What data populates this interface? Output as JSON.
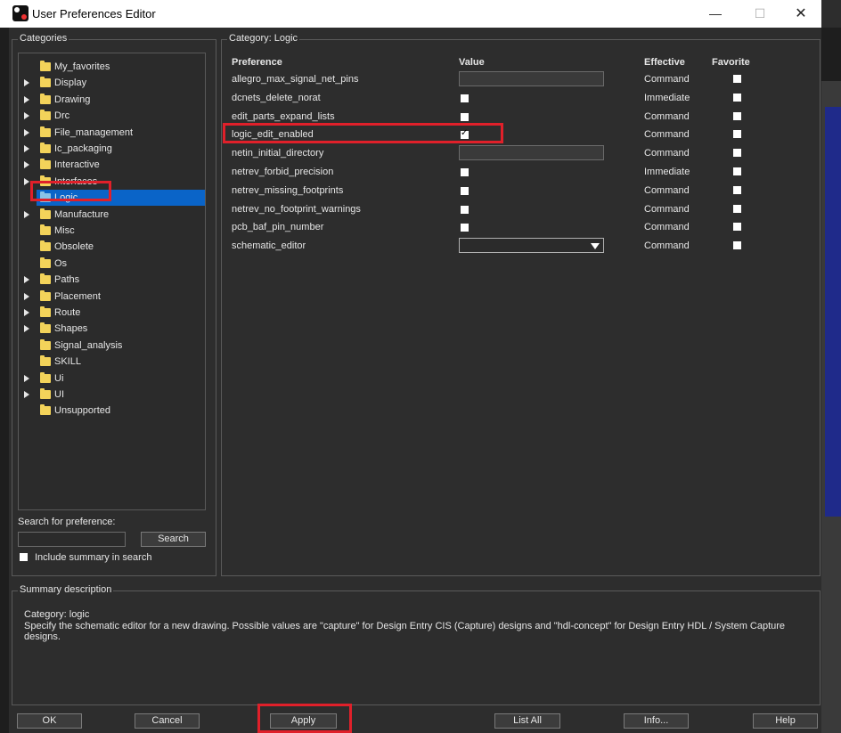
{
  "window": {
    "title": "User Preferences Editor",
    "minimize_glyph": "—",
    "maximize_glyph": "☐",
    "close_glyph": "✕"
  },
  "categories": {
    "title": "Categories",
    "items": [
      {
        "label": "My_favorites",
        "expandable": false,
        "selected": false
      },
      {
        "label": "Display",
        "expandable": true,
        "selected": false
      },
      {
        "label": "Drawing",
        "expandable": true,
        "selected": false
      },
      {
        "label": "Drc",
        "expandable": true,
        "selected": false
      },
      {
        "label": "File_management",
        "expandable": true,
        "selected": false
      },
      {
        "label": "Ic_packaging",
        "expandable": true,
        "selected": false
      },
      {
        "label": "Interactive",
        "expandable": true,
        "selected": false
      },
      {
        "label": "Interfaces",
        "expandable": true,
        "selected": false
      },
      {
        "label": "Logic",
        "expandable": false,
        "selected": true
      },
      {
        "label": "Manufacture",
        "expandable": true,
        "selected": false
      },
      {
        "label": "Misc",
        "expandable": false,
        "selected": false
      },
      {
        "label": "Obsolete",
        "expandable": false,
        "selected": false
      },
      {
        "label": "Os",
        "expandable": false,
        "selected": false
      },
      {
        "label": "Paths",
        "expandable": true,
        "selected": false
      },
      {
        "label": "Placement",
        "expandable": true,
        "selected": false
      },
      {
        "label": "Route",
        "expandable": true,
        "selected": false
      },
      {
        "label": "Shapes",
        "expandable": true,
        "selected": false
      },
      {
        "label": "Signal_analysis",
        "expandable": false,
        "selected": false
      },
      {
        "label": "SKILL",
        "expandable": false,
        "selected": false
      },
      {
        "label": "Ui",
        "expandable": true,
        "selected": false
      },
      {
        "label": "UI",
        "expandable": true,
        "selected": false
      },
      {
        "label": "Unsupported",
        "expandable": false,
        "selected": false
      }
    ],
    "search_label": "Search for preference:",
    "search_value": "",
    "search_button": "Search",
    "include_summary_label": "Include summary in search",
    "include_summary_checked": false
  },
  "category_panel": {
    "title": "Category:  Logic",
    "headers": {
      "preference": "Preference",
      "value": "Value",
      "effective": "Effective",
      "favorite": "Favorite"
    },
    "rows": [
      {
        "name": "allegro_max_signal_net_pins",
        "value_type": "text",
        "value": "",
        "effective": "Command",
        "favorite": false
      },
      {
        "name": "dcnets_delete_norat",
        "value_type": "checkbox",
        "checked": false,
        "effective": "Immediate",
        "favorite": false
      },
      {
        "name": "edit_parts_expand_lists",
        "value_type": "checkbox",
        "checked": false,
        "effective": "Command",
        "favorite": false
      },
      {
        "name": "logic_edit_enabled",
        "value_type": "checkbox",
        "checked": true,
        "effective": "Command",
        "favorite": false
      },
      {
        "name": "netin_initial_directory",
        "value_type": "text",
        "value": "",
        "effective": "Command",
        "favorite": false
      },
      {
        "name": "netrev_forbid_precision",
        "value_type": "checkbox",
        "checked": false,
        "effective": "Immediate",
        "favorite": false
      },
      {
        "name": "netrev_missing_footprints",
        "value_type": "checkbox",
        "checked": false,
        "effective": "Command",
        "favorite": false
      },
      {
        "name": "netrev_no_footprint_warnings",
        "value_type": "checkbox",
        "checked": false,
        "effective": "Command",
        "favorite": false
      },
      {
        "name": "pcb_baf_pin_number",
        "value_type": "checkbox",
        "checked": false,
        "effective": "Command",
        "favorite": false
      },
      {
        "name": "schematic_editor",
        "value_type": "select",
        "value": "",
        "effective": "Command",
        "favorite": false
      }
    ]
  },
  "summary": {
    "title": "Summary description",
    "category_line": "Category: logic",
    "description": "Specify the schematic editor for a new drawing. Possible values are \"capture\" for Design Entry CIS (Capture) designs and \"hdl-concept\" for Design Entry HDL / System Capture designs."
  },
  "buttons": {
    "ok": "OK",
    "cancel": "Cancel",
    "apply": "Apply",
    "list_all": "List All",
    "info": "Info...",
    "help": "Help"
  },
  "colors": {
    "background": "#2d2d2d",
    "selection": "#0a64c8",
    "folder": "#f3d35a",
    "highlight_box": "#e0202a"
  }
}
